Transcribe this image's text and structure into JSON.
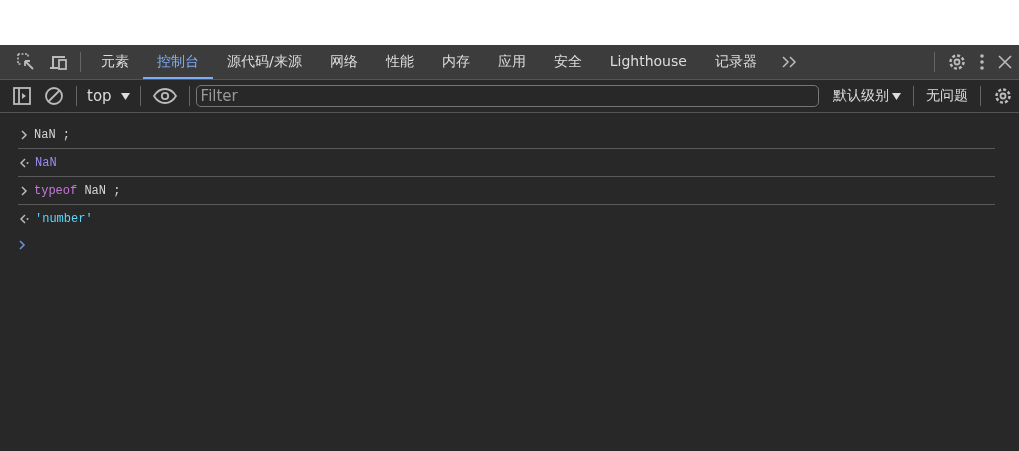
{
  "tabs": [
    {
      "label": "元素",
      "selected": false
    },
    {
      "label": "控制台",
      "selected": true
    },
    {
      "label": "源代码/来源",
      "selected": false
    },
    {
      "label": "网络",
      "selected": false
    },
    {
      "label": "性能",
      "selected": false
    },
    {
      "label": "内存",
      "selected": false
    },
    {
      "label": "应用",
      "selected": false
    },
    {
      "label": "安全",
      "selected": false
    },
    {
      "label": "Lighthouse",
      "selected": false
    },
    {
      "label": "记录器",
      "selected": false
    }
  ],
  "toolbar": {
    "context": "top",
    "filter": {
      "placeholder": "Filter"
    },
    "levels": "默认级别",
    "issues": "无问题"
  },
  "console": [
    {
      "kind": "input",
      "tokens": [
        {
          "kind": "plain",
          "text": "NaN ;"
        }
      ]
    },
    {
      "kind": "output",
      "tokens": [
        {
          "kind": "number",
          "text": "NaN"
        }
      ]
    },
    {
      "kind": "input",
      "tokens": [
        {
          "kind": "keyword",
          "text": "typeof"
        },
        {
          "kind": "plain",
          "text": " NaN ;"
        }
      ]
    },
    {
      "kind": "output",
      "tokens": [
        {
          "kind": "string",
          "text": "'number'"
        }
      ]
    }
  ]
}
